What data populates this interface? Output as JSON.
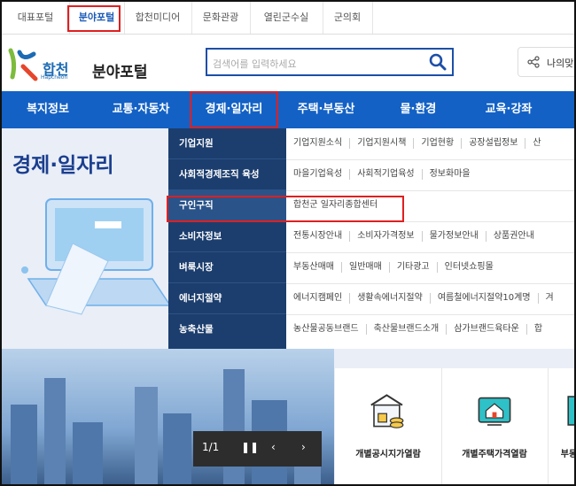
{
  "top_tabs": [
    {
      "label": "대표포털"
    },
    {
      "label": "분야포털"
    },
    {
      "label": "합천미디어"
    },
    {
      "label": "문화관광"
    },
    {
      "label": "열린군수실"
    },
    {
      "label": "군의회"
    }
  ],
  "header": {
    "logo_text": "합천",
    "logo_eng": "Hapcheon",
    "portal_title": "분야포털",
    "search_placeholder": "검색어를 입력하세요",
    "mypage_label": "나의맞"
  },
  "main_nav": [
    {
      "label": "복지정보"
    },
    {
      "label": "교통·자동차"
    },
    {
      "label": "경제·일자리"
    },
    {
      "label": "주택·부동산"
    },
    {
      "label": "물·환경"
    },
    {
      "label": "교육·강좌"
    }
  ],
  "hero_title": "경제·일자리",
  "dropdown": {
    "categories": [
      {
        "label": "기업지원",
        "links": [
          "기업지원소식",
          "기업지원시책",
          "기업현황",
          "공장설립정보",
          "산"
        ]
      },
      {
        "label": "사회적경제조직 육성",
        "links": [
          "마을기업육성",
          "사회적기업육성",
          "정보화마을"
        ]
      },
      {
        "label": "구인구직",
        "links": [
          "합천군 일자리종합센터"
        ]
      },
      {
        "label": "소비자정보",
        "links": [
          "전통시장안내",
          "소비자가격정보",
          "물가정보안내",
          "상품권안내"
        ]
      },
      {
        "label": "벼룩시장",
        "links": [
          "부동산매매",
          "일반매매",
          "기타광고",
          "인터넷쇼핑몰"
        ]
      },
      {
        "label": "에너지절약",
        "links": [
          "에너지캠페인",
          "생활속에너지절약",
          "여름철에너지절약10계명",
          "겨"
        ]
      },
      {
        "label": "농축산물",
        "links": [
          "농산물공동브랜드",
          "축산물브랜드소개",
          "삼가브랜드육타운",
          "합"
        ]
      }
    ]
  },
  "slider": {
    "counter": "1/1"
  },
  "services": [
    {
      "label": "개별공시지가열람"
    },
    {
      "label": "개별주택가격열람"
    },
    {
      "label": "부동"
    }
  ],
  "colors": {
    "nav_bg": "#1361c5",
    "dropdown_bg": "#1c3e6e",
    "highlight": "#e01f1f"
  }
}
